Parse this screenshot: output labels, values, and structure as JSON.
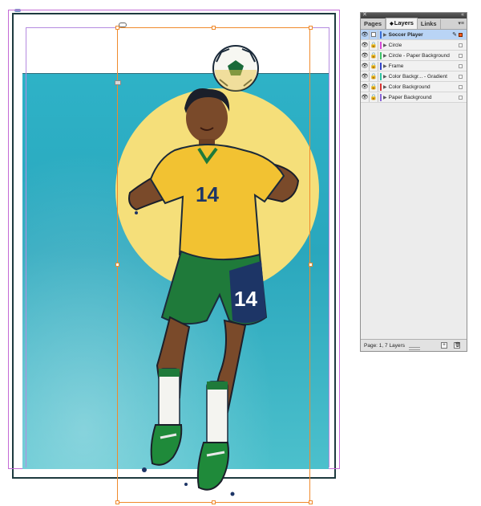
{
  "panel": {
    "tabs": [
      {
        "label": "Pages"
      },
      {
        "label": "Layers",
        "active": true
      },
      {
        "label": "Links"
      }
    ],
    "layers": [
      {
        "name": "Soccer Player",
        "color": "#3a6fd8",
        "selected": true
      },
      {
        "name": "Circle",
        "color": "#d84ad8"
      },
      {
        "name": "Circle - Paper Background",
        "color": "#3fc46a"
      },
      {
        "name": "Frame",
        "color": "#3345c9"
      },
      {
        "name": "Color Backgr... - Gradient",
        "color": "#2ec4a2"
      },
      {
        "name": "Color Background",
        "color": "#d83434"
      },
      {
        "name": "Paper Background",
        "color": "#8a66d8"
      }
    ],
    "footer_text": "Page: 1, 7 Layers"
  },
  "artwork": {
    "jersey_number_front": "14",
    "shorts_number": "14"
  },
  "colors": {
    "background_teal": "#2eb2c7",
    "circle_yellow": "#f5df7a",
    "jersey_yellow": "#f2c232",
    "shorts_green": "#1f7a3a",
    "number_navy": "#1d3566",
    "selection_orange": "#f08a2c",
    "guide_purple": "#b58be0"
  }
}
